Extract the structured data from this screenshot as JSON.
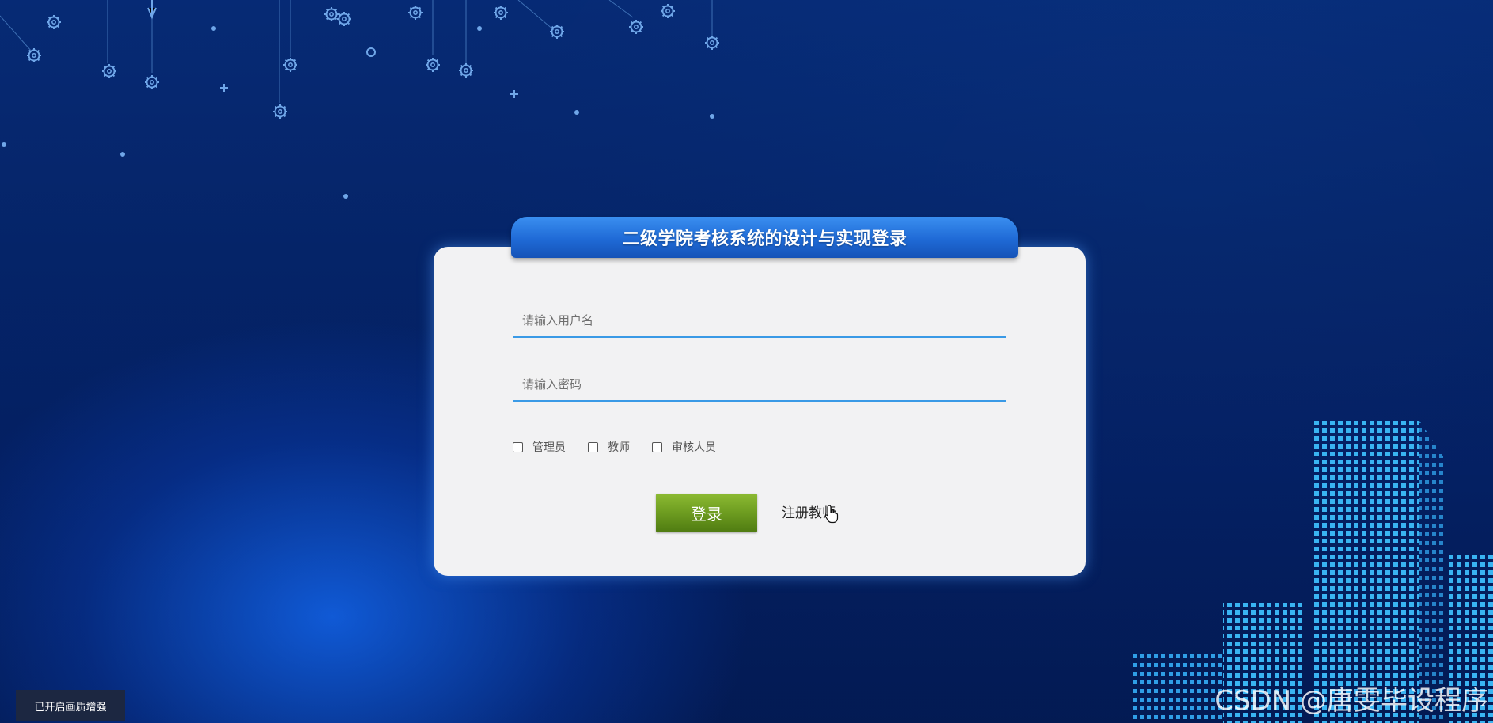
{
  "login": {
    "title": "二级学院考核系统的设计与实现登录",
    "username_placeholder": "请输入用户名",
    "password_placeholder": "请输入密码",
    "roles": [
      "管理员",
      "教师",
      "审核人员"
    ],
    "login_button": "登录",
    "register_link": "注册教师"
  },
  "overlay": {
    "enhance_badge": "已开启画质增强",
    "watermark": "CSDN @唐雯毕设程序"
  },
  "colors": {
    "background": "#06286e",
    "title_tab": "#1f6ad6",
    "card": "#f2f2f3",
    "input_underline": "#3a9ae6",
    "login_button": "#6d9c20"
  },
  "icons": {
    "cursor": "hand-pointer-icon",
    "decoration": "gear-icon"
  }
}
